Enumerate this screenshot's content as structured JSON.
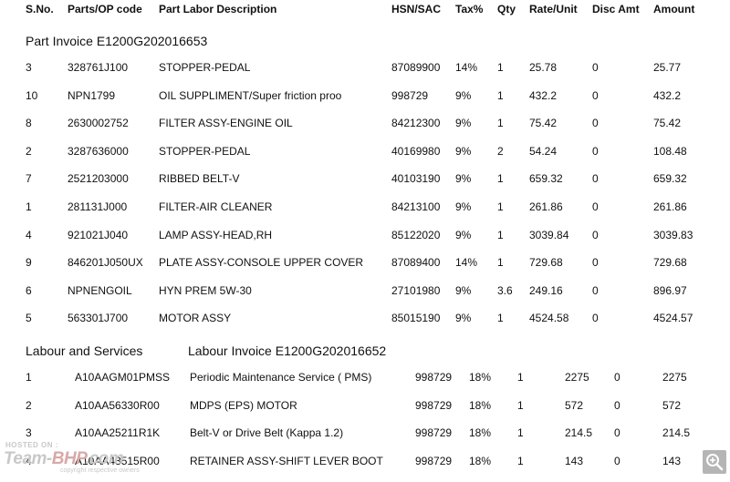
{
  "headers": [
    "S.No.",
    "Parts/OP code",
    "Part Labor Description",
    "HSN/SAC",
    "Tax%",
    "Qty",
    "Rate/Unit",
    "Disc Amt",
    "Amount"
  ],
  "part_section": {
    "title": "Part Invoice E1200G202016653",
    "rows": [
      {
        "sno": "3",
        "code": "328761J100",
        "desc": "STOPPER-PEDAL",
        "hsn": "87089900",
        "tax": "14%",
        "qty": "1",
        "rate": "25.78",
        "disc": "0",
        "amount": "25.77"
      },
      {
        "sno": "10",
        "code": "NPN1799",
        "desc": "OIL SUPPLIMENT/Super friction proo",
        "hsn": "998729",
        "tax": "9%",
        "qty": "1",
        "rate": "432.2",
        "disc": "0",
        "amount": "432.2"
      },
      {
        "sno": "8",
        "code": "2630002752",
        "desc": "FILTER ASSY-ENGINE OIL",
        "hsn": "84212300",
        "tax": "9%",
        "qty": "1",
        "rate": "75.42",
        "disc": "0",
        "amount": "75.42"
      },
      {
        "sno": "2",
        "code": "3287636000",
        "desc": "STOPPER-PEDAL",
        "hsn": "40169980",
        "tax": "9%",
        "qty": "2",
        "rate": "54.24",
        "disc": "0",
        "amount": "108.48"
      },
      {
        "sno": "7",
        "code": "2521203000",
        "desc": "RIBBED BELT-V",
        "hsn": "40103190",
        "tax": "9%",
        "qty": "1",
        "rate": "659.32",
        "disc": "0",
        "amount": "659.32"
      },
      {
        "sno": "1",
        "code": "281131J000",
        "desc": "FILTER-AIR CLEANER",
        "hsn": "84213100",
        "tax": "9%",
        "qty": "1",
        "rate": "261.86",
        "disc": "0",
        "amount": "261.86"
      },
      {
        "sno": "4",
        "code": "921021J040",
        "desc": "LAMP ASSY-HEAD,RH",
        "hsn": "85122020",
        "tax": "9%",
        "qty": "1",
        "rate": "3039.84",
        "disc": "0",
        "amount": "3039.83"
      },
      {
        "sno": "9",
        "code": "846201J050UX",
        "desc": "PLATE ASSY-CONSOLE UPPER COVER",
        "hsn": "87089400",
        "tax": "14%",
        "qty": "1",
        "rate": "729.68",
        "disc": "0",
        "amount": "729.68"
      },
      {
        "sno": "6",
        "code": "NPNENGOIL",
        "desc": "HYN PREM 5W-30",
        "hsn": "27101980",
        "tax": "9%",
        "qty": "3.6",
        "rate": "249.16",
        "disc": "0",
        "amount": "896.97"
      },
      {
        "sno": "5",
        "code": "563301J700",
        "desc": "MOTOR ASSY",
        "hsn": "85015190",
        "tax": "9%",
        "qty": "1",
        "rate": "4524.58",
        "disc": "0",
        "amount": "4524.57"
      }
    ]
  },
  "labour_section": {
    "label": "Labour and Services",
    "title": "Labour Invoice E1200G202016652",
    "rows": [
      {
        "sno": "1",
        "code": "A10AAGM01PMSS",
        "desc": "Periodic Maintenance Service ( PMS)",
        "hsn": "998729",
        "tax": "18%",
        "qty": "1",
        "rate": "2275",
        "disc": "0",
        "amount": "2275"
      },
      {
        "sno": "2",
        "code": "A10AA56330R00",
        "desc": "MDPS (EPS) MOTOR",
        "hsn": "998729",
        "tax": "18%",
        "qty": "1",
        "rate": "572",
        "disc": "0",
        "amount": "572"
      },
      {
        "sno": "3",
        "code": "A10AA25211R1K",
        "desc": "Belt-V or Drive Belt (Kappa 1.2)",
        "hsn": "998729",
        "tax": "18%",
        "qty": "1",
        "rate": "214.5",
        "disc": "0",
        "amount": "214.5"
      },
      {
        "sno": "4",
        "code": "A10AA43515R00",
        "desc": "RETAINER ASSY-SHIFT LEVER BOOT",
        "hsn": "998729",
        "tax": "18%",
        "qty": "1",
        "rate": "143",
        "disc": "0",
        "amount": "143"
      }
    ]
  },
  "watermark": {
    "hosted": "HOSTED ON :",
    "brand_a": "Team-",
    "brand_b": "BHP",
    "brand_c": ".com",
    "copyright": "copyright respective owners"
  },
  "zoom_icon": "magnifier-plus-icon"
}
